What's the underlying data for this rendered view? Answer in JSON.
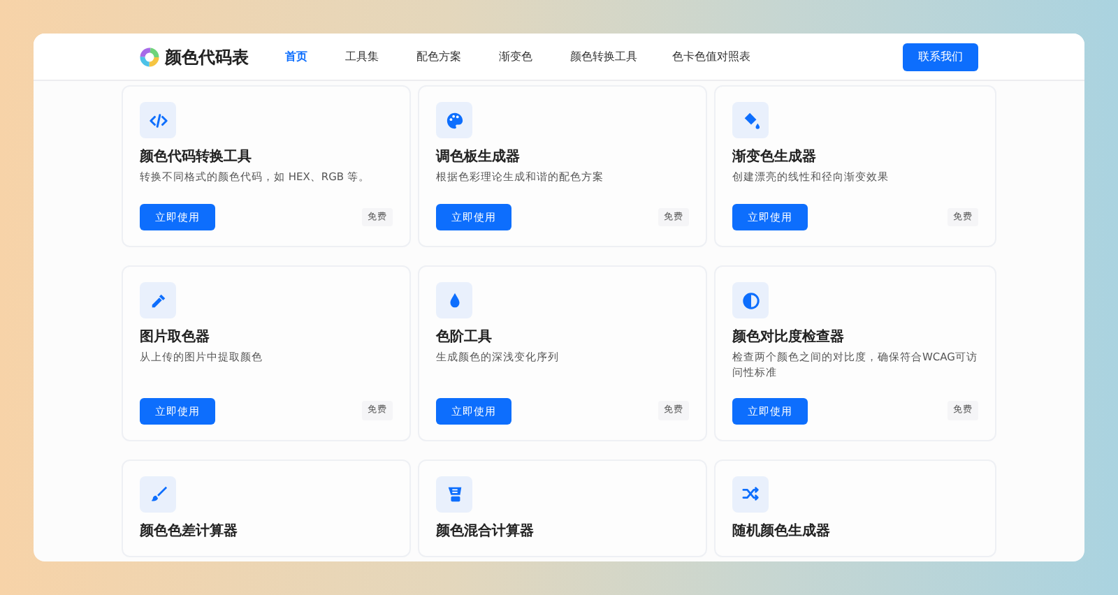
{
  "header": {
    "site_title": "颜色代码表",
    "nav": [
      {
        "label": "首页",
        "selected": true
      },
      {
        "label": "工具集",
        "selected": false
      },
      {
        "label": "配色方案",
        "selected": false
      },
      {
        "label": "渐变色",
        "selected": false
      },
      {
        "label": "颜色转换工具",
        "selected": false
      },
      {
        "label": "色卡色值对照表",
        "selected": false
      }
    ],
    "contact_button": "联系我们"
  },
  "tools": [
    {
      "title": "颜色代码转换工具",
      "description": "转换不同格式的颜色代码，如 HEX、RGB 等。",
      "button": "立即使用",
      "tag": "免费"
    },
    {
      "title": "调色板生成器",
      "description": "根据色彩理论生成和谐的配色方案",
      "button": "立即使用",
      "tag": "免费"
    },
    {
      "title": "渐变色生成器",
      "description": "创建漂亮的线性和径向渐变效果",
      "button": "立即使用",
      "tag": "免费"
    },
    {
      "title": "图片取色器",
      "description": "从上传的图片中提取颜色",
      "button": "立即使用",
      "tag": "免费"
    },
    {
      "title": "色阶工具",
      "description": "生成颜色的深浅变化序列",
      "button": "立即使用",
      "tag": "免费"
    },
    {
      "title": "颜色对比度检查器",
      "description": "检查两个颜色之间的对比度，确保符合WCAG可访问性标准",
      "button": "立即使用",
      "tag": "免费"
    },
    {
      "title": "颜色色差计算器"
    },
    {
      "title": "颜色混合计算器"
    },
    {
      "title": "随机颜色生成器"
    }
  ]
}
